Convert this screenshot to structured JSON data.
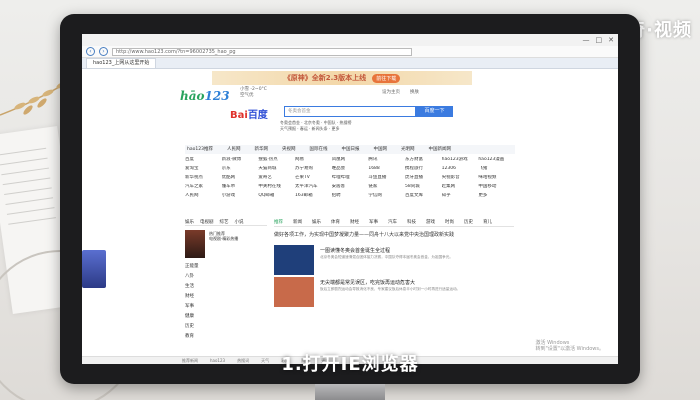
{
  "overlay": {
    "brand": "天奇·视频",
    "caption": "1.打开IE浏览器"
  },
  "browser": {
    "url": "http://www.hao123.com/?tn=96002735_hao_pg",
    "tab_title": "hao123_上网从这里开始",
    "window_controls": [
      "—",
      "□",
      "✕"
    ],
    "nav_icons": [
      "back-icon",
      "forward-icon"
    ]
  },
  "page": {
    "banner": {
      "text": "《原神》全新2.3版本上线",
      "button": "前往下载"
    },
    "logo": {
      "part1": "hāo",
      "part2": "123"
    },
    "weather": [
      "小雪 -2~0°C",
      "空气优"
    ],
    "toplinks": [
      "设为主页",
      "换肤"
    ],
    "baidu_logo": {
      "left": "Bai",
      "right": "百度"
    },
    "search": {
      "placeholder": "冬奥会首金 ",
      "button": "百度一下"
    },
    "hotwords": [
      "冬奥会首金 · 北京冬奥 · 中国队 · 热搜榜",
      "天气预报 · 春运 · 新闻头条 · 更多"
    ],
    "categories": [
      "hao123推荐",
      "人民网",
      "新华网",
      "央视网",
      "国际在线",
      "中国日报",
      "中国网",
      "光明网",
      "中国新闻网"
    ],
    "links": [
      "百度",
      "新浪·微博",
      "搜狐·热点",
      "网易",
      "凤凰网",
      "腾讯",
      "东方财富",
      "hao123游戏",
      "hao123漫画",
      "爱淘宝",
      "京东",
      "天猫商城",
      "苏宁易购",
      "唯品会",
      "1688",
      "携程旅行",
      "12306",
      "飞猪",
      "新华视点",
      "优酷网",
      "爱奇艺",
      "芒果TV",
      "哔哩哔哩",
      "斗鱼直播",
      "虎牙直播",
      "央视影音",
      "咪咕视频",
      "汽车之家",
      "懂车帝",
      "中关村在线",
      "太平洋汽车",
      "安居客",
      "链家",
      "58同城",
      "赶集网",
      "中国移动",
      "人民网",
      "小游戏",
      "QQ邮箱",
      "163邮箱",
      "招聘",
      "学信网",
      "百度文库",
      "知乎",
      "更多"
    ],
    "left_tabs": [
      "娱乐",
      "电视剧",
      "综艺",
      "小说"
    ],
    "poster_title": [
      "热门推荐",
      "电视剧·精彩热播"
    ],
    "left_list": [
      {
        "label": "正能量",
        "extra": ""
      },
      {
        "label": "八卦",
        "extra": ""
      },
      {
        "label": "生活",
        "extra": ""
      },
      {
        "label": "财经",
        "extra": ""
      },
      {
        "label": "军事",
        "extra": ""
      },
      {
        "label": "健康",
        "extra": ""
      },
      {
        "label": "历史",
        "extra": ""
      },
      {
        "label": "教育",
        "extra": ""
      }
    ],
    "news_tabs": [
      "推荐",
      "新闻",
      "娱乐",
      "体育",
      "财经",
      "军事",
      "汽车",
      "科技",
      "游戏",
      "时尚",
      "历史",
      "育儿"
    ],
    "headline": "做好各项工作，为实现中国梦凝聚力量——同舟十八大以来党中央治国理政新实践",
    "news": [
      {
        "title": "一图读懂冬奥会首金诞生全过程",
        "desc": "北京冬奥会短道速滑混合团体接力决赛，中国队夺得本届冬奥会首金，为祖国争光。",
        "thumb_color": "#1f3f7a"
      },
      {
        "title": "无尖端都是常见误区，吃完饭再运动危害大",
        "desc": "饭后立即剧烈运动会导致消化不良，专家建议饭后休息半小时到一小时再进行适量运动。",
        "thumb_color": "#c86a4a"
      }
    ],
    "status": [
      "推荐新闻",
      "hao123",
      "热搜词",
      "天气",
      "彩票",
      "购物",
      "更多"
    ],
    "activate_text": [
      "激活 Windows",
      "转到\"设置\"以激活 Windows。"
    ]
  }
}
